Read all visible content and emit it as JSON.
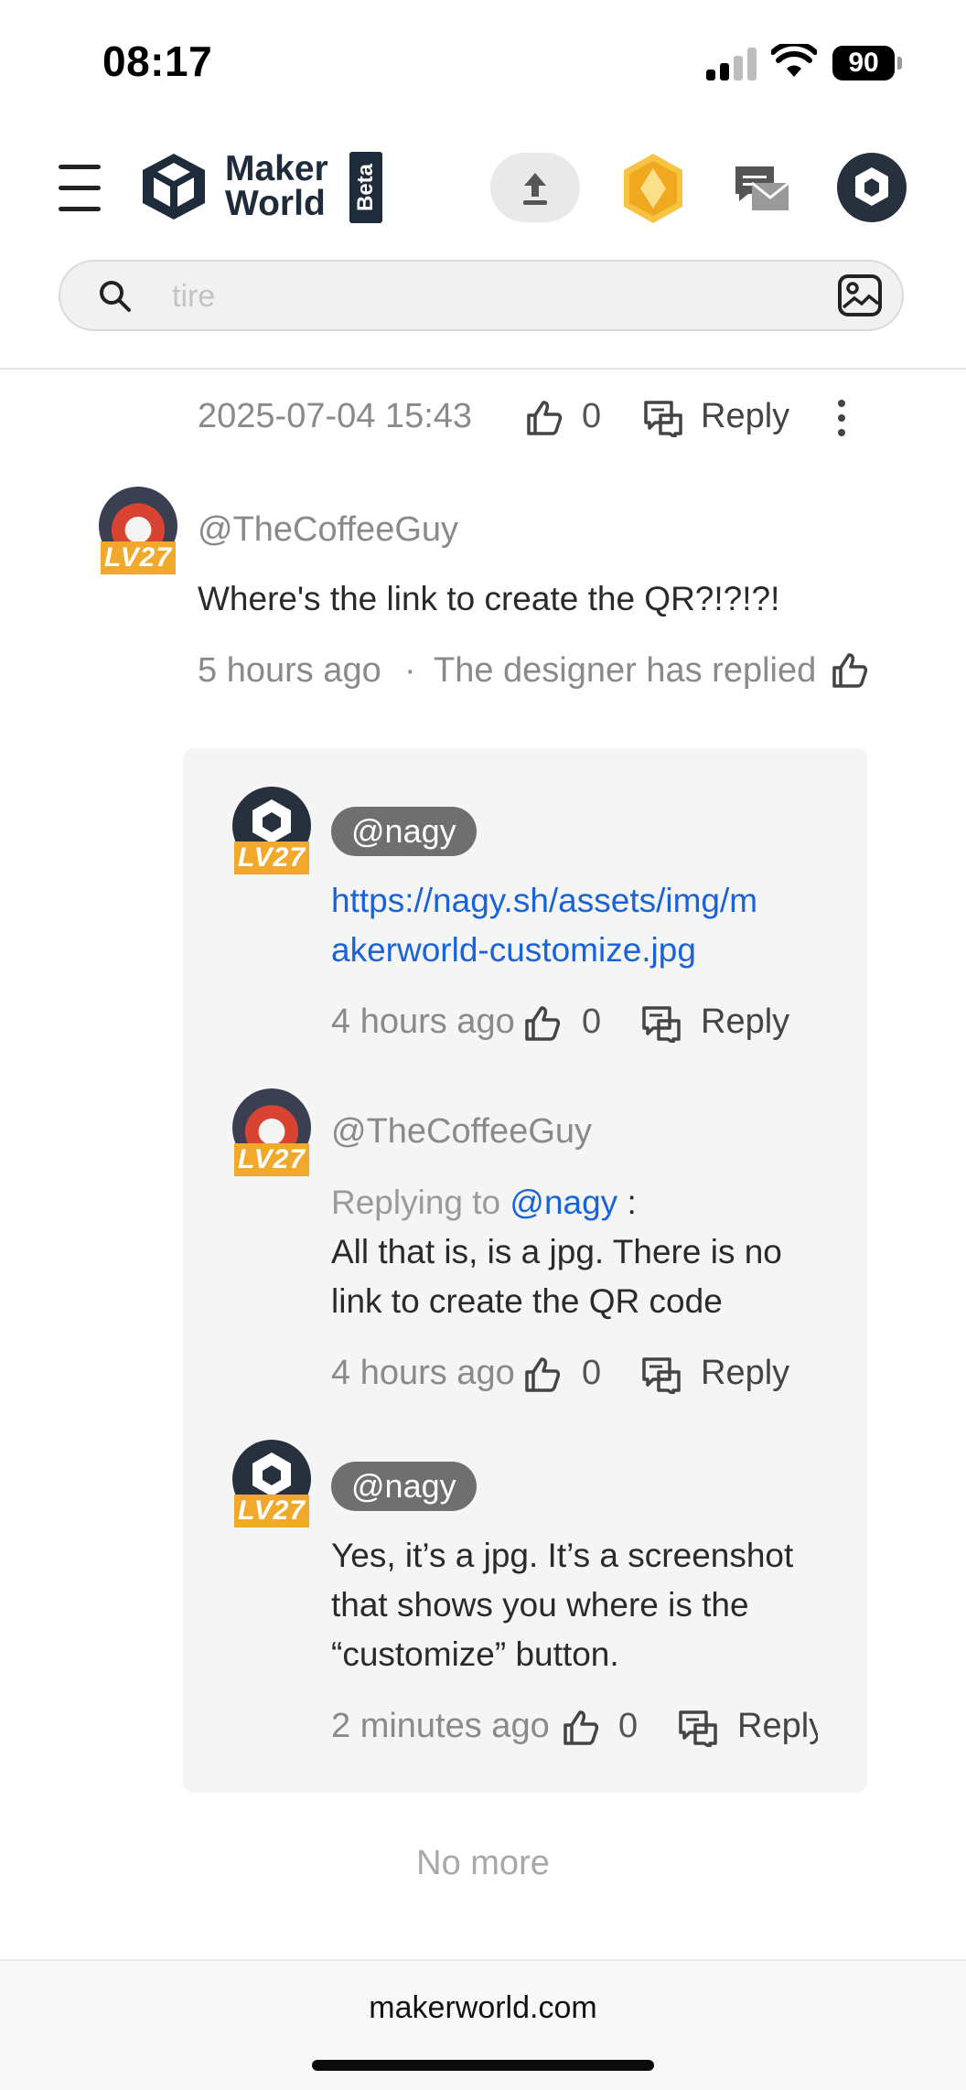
{
  "status_bar": {
    "time": "08:17",
    "battery": "90"
  },
  "header": {
    "brand_line1": "Maker",
    "brand_line2": "World",
    "beta": "Beta",
    "search_placeholder": "tire"
  },
  "top_comment_meta": {
    "date": "2025-07-04 15:43",
    "likes": "0",
    "reply": "Reply"
  },
  "comment": {
    "user": "@TheCoffeeGuy",
    "level": "LV27",
    "text": "Where's the link to create the QR?!?!?!",
    "time": "5 hours ago",
    "sep": "·",
    "designer_note": "The designer has replied"
  },
  "replies": [
    {
      "user": "@nagy",
      "level": "LV27",
      "link_line1": "https://nagy.sh/assets/img/m",
      "link_line2": "akerworld-customize.jpg",
      "time": "4 hours ago",
      "likes": "0",
      "reply": "Reply"
    },
    {
      "user": "@TheCoffeeGuy",
      "level": "LV27",
      "replying_prefix": "Replying to",
      "replying_user": "@nagy",
      "replying_colon": ":",
      "text_line1": "All that is, is a jpg. There is no",
      "text_line2": "link to create the QR code",
      "time": "4 hours ago",
      "likes": "0",
      "reply": "Reply"
    },
    {
      "user": "@nagy",
      "level": "LV27",
      "text_line1": "Yes, it’s a jpg. It’s a screenshot",
      "text_line2": "that shows you where is the",
      "text_line3": "“customize” button.",
      "time": "2 minutes ago",
      "likes": "0",
      "reply": "Reply"
    }
  ],
  "no_more": "No more",
  "footer": {
    "domain": "makerworld.com"
  },
  "colors": {
    "link": "#1a63d6",
    "level_badge": "#f1a92b",
    "brand_dark": "#1d2b3a"
  }
}
